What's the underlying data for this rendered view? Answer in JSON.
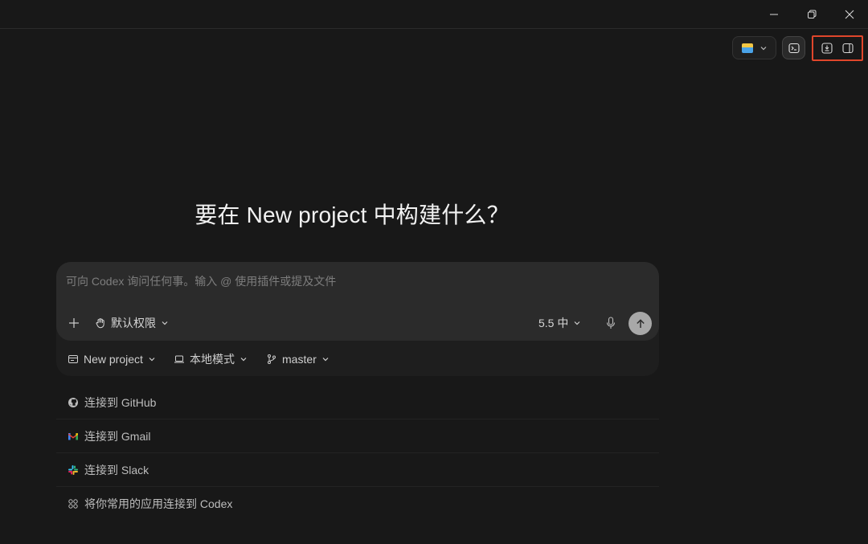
{
  "window": {
    "minimize_icon": "minimize-icon",
    "maximize_icon": "restore-icon",
    "close_icon": "close-icon"
  },
  "toolbar": {
    "open_in_icon": "folder-app-icon",
    "terminal_icon": "terminal-icon",
    "group_icons": [
      "download-panel-icon",
      "sidebar-toggle-icon"
    ],
    "highlight_color": "#e0462b"
  },
  "heading": "要在 New project 中构建什么？",
  "composer": {
    "placeholder": "可向 Codex 询问任何事。输入 @ 使用插件或提及文件",
    "value": "",
    "add_icon": "plus-icon",
    "permission_label": "默认权限",
    "permission_icon": "hand-icon",
    "model_label": "5.5 中",
    "mic_icon": "microphone-icon",
    "send_icon": "arrow-up-icon"
  },
  "context": {
    "project_label": "New project",
    "mode_label": "本地模式",
    "branch_label": "master"
  },
  "connectors": [
    {
      "label": "连接到 GitHub",
      "icon": "github-icon"
    },
    {
      "label": "连接到 Gmail",
      "icon": "gmail-icon"
    },
    {
      "label": "连接到 Slack",
      "icon": "slack-icon"
    },
    {
      "label": "将你常用的应用连接到 Codex",
      "icon": "apps-icon"
    }
  ]
}
